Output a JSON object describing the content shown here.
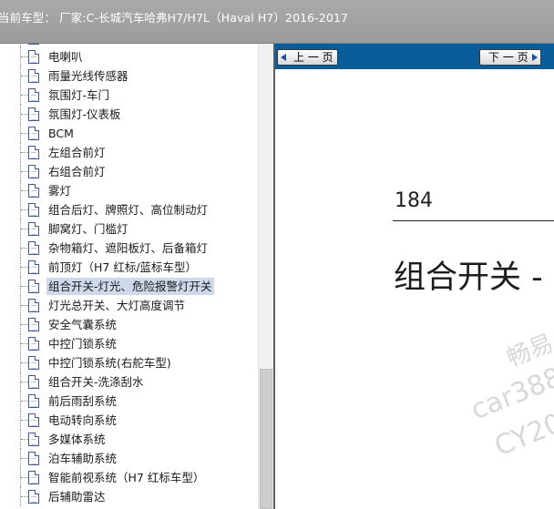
{
  "titlebar": {
    "title": "当前车型：  厂家:C-长城汽车哈弗H7/H7L（Haval H7）2016-2017"
  },
  "tree": {
    "items": [
      {
        "label": "电喇叭",
        "icon": "document-icon"
      },
      {
        "label": "雨量光线传感器",
        "icon": "document-icon"
      },
      {
        "label": "氛围灯-车门",
        "icon": "document-icon"
      },
      {
        "label": "氛围灯-仪表板",
        "icon": "document-icon"
      },
      {
        "label": "BCM",
        "icon": "document-icon"
      },
      {
        "label": "左组合前灯",
        "icon": "document-icon"
      },
      {
        "label": "右组合前灯",
        "icon": "document-icon"
      },
      {
        "label": "雾灯",
        "icon": "document-icon"
      },
      {
        "label": "组合后灯、牌照灯、高位制动灯",
        "icon": "document-icon"
      },
      {
        "label": "脚窝灯、门槛灯",
        "icon": "document-icon"
      },
      {
        "label": "杂物箱灯、遮阳板灯、后备箱灯",
        "icon": "document-icon"
      },
      {
        "label": "前顶灯（H7 红标/蓝标车型）",
        "icon": "document-icon"
      },
      {
        "label": "组合开关-灯光、危险报警灯开关",
        "icon": "document-icon",
        "selected": true
      },
      {
        "label": "灯光总开关、大灯高度调节",
        "icon": "document-icon"
      },
      {
        "label": "安全气囊系统",
        "icon": "document-icon"
      },
      {
        "label": "中控门锁系统",
        "icon": "document-icon"
      },
      {
        "label": "中控门锁系统(右舵车型)",
        "icon": "document-icon"
      },
      {
        "label": "组合开关-洗涤刮水",
        "icon": "document-icon"
      },
      {
        "label": "前后雨刮系统",
        "icon": "document-icon"
      },
      {
        "label": "电动转向系统",
        "icon": "document-icon"
      },
      {
        "label": "多媒体系统",
        "icon": "document-icon"
      },
      {
        "label": "泊车辅助系统",
        "icon": "document-icon"
      },
      {
        "label": "智能前视系统（H7 红标车型）",
        "icon": "document-icon"
      },
      {
        "label": "后辅助雷达",
        "icon": "document-icon"
      }
    ]
  },
  "viewer": {
    "prev_label": "上 一 页",
    "next_label": "下 一 页",
    "prev_icon": "arrow-left-icon",
    "next_icon": "arrow-right-icon",
    "page_number": "184",
    "section_heading": "组合开关 -",
    "watermark_lines": [
      "畅易",
      "car388.",
      "CY20"
    ]
  },
  "colors": {
    "titlebar": "#a3a3a3",
    "toolbar": "#0a5d9b",
    "selection": "#cfd9ec"
  }
}
